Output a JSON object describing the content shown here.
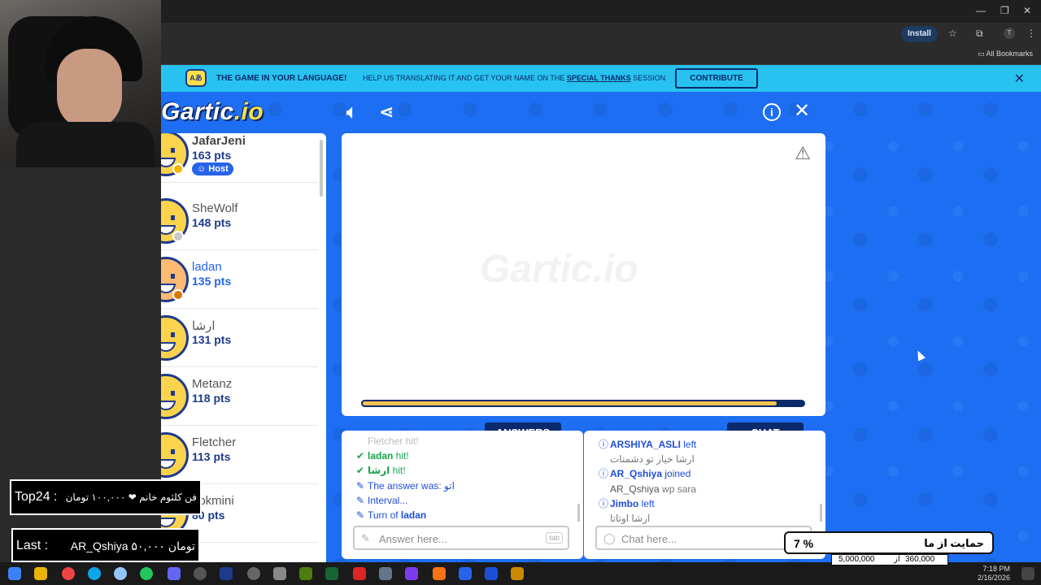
{
  "browser": {
    "install_label": "Install",
    "bookmarks_label": "All Bookmarks",
    "profile_initial": "T"
  },
  "banner": {
    "title": "THE GAME IN YOUR LANGUAGE!",
    "text_before": "HELP US TRANSLATING IT AND GET YOUR NAME ON THE",
    "text_link": "SPECIAL THANKS",
    "text_after": "SESSION",
    "contribute_label": "CONTRIBUTE"
  },
  "game": {
    "logo": "Gartic",
    "logo_suffix": ".io",
    "watermark": "Gartic.io",
    "timer_fraction": 0.94
  },
  "players": [
    {
      "name": "JafarJeni",
      "points": "163 pts",
      "badge": "Host",
      "status_color": "#f5b400"
    },
    {
      "name": "SheWolf",
      "points": "148 pts",
      "status_color": "#c8c8c8"
    },
    {
      "name": "ladan",
      "points": "135 pts",
      "status_color": "#d97706",
      "drawing": true
    },
    {
      "name": "ارشا",
      "points": "131 pts"
    },
    {
      "name": "Metanz",
      "points": "118 pts"
    },
    {
      "name": "Fletcher",
      "points": "113 pts"
    },
    {
      "name": "apkmini",
      "points": "80 pts"
    }
  ],
  "tabs": {
    "answers": "ANSWERS",
    "chat": "CHAT"
  },
  "answers": {
    "lines": [
      {
        "type": "faded",
        "text": "Fletcher hit!"
      },
      {
        "type": "hit",
        "name": "ladan",
        "text": " hit!"
      },
      {
        "type": "hit",
        "name": "ارشا",
        "text": " hit!"
      },
      {
        "type": "sys",
        "text": "The answer was: اتو"
      },
      {
        "type": "sys",
        "text": "Interval..."
      },
      {
        "type": "sys",
        "name": "ladan",
        "text": "Turn of "
      }
    ],
    "placeholder": "Answer here...",
    "tab_hint": "tab"
  },
  "chat": {
    "lines": [
      {
        "type": "sys",
        "name": "ARSHIYA_ASLI",
        "text": " left"
      },
      {
        "type": "gray",
        "text": "ارشا خیار تو دشمنات"
      },
      {
        "type": "sys",
        "name": "AR_Qshiya",
        "text": " joined"
      },
      {
        "type": "gray",
        "name": "AR_Qshiya",
        "text": " wp sara"
      },
      {
        "type": "sys",
        "name": "Jimbo",
        "text": " left"
      },
      {
        "type": "gray",
        "text": "ارشا اوتاتا"
      }
    ],
    "placeholder": "Chat here..."
  },
  "overlays": {
    "top_label": "Top24 :",
    "top_value": "فن کلثوم خانم ❤ ۱۰۰,۰۰۰ تومان",
    "last_label": "Last :",
    "last_value": "AR_Qshiya ۵۰,۰۰۰ تومان",
    "donate_percent": "7 %",
    "donate_label": "حمایت از ما",
    "donate_goal": "5,000,000",
    "donate_of": "از",
    "donate_current": "360,000"
  },
  "taskbar": {
    "time": "7:18 PM",
    "date": "2/16/2026"
  }
}
